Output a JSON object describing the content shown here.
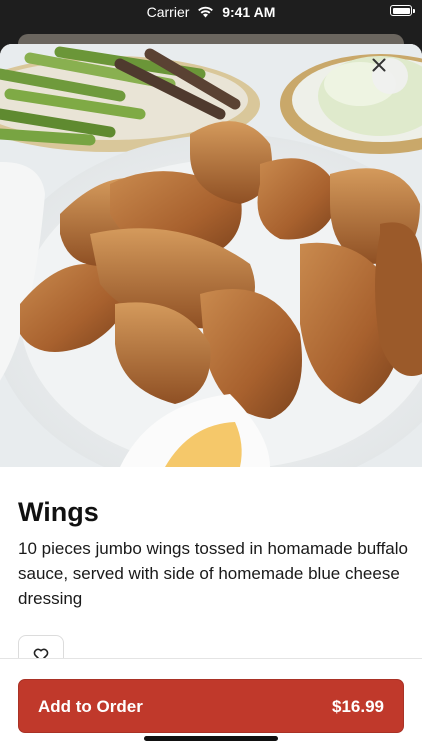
{
  "status_bar": {
    "carrier": "Carrier",
    "time": "9:41 AM",
    "icons": [
      "wifi-icon",
      "battery-icon"
    ]
  },
  "item": {
    "photo_subject": "fried chicken wings",
    "title": "Wings",
    "description": "10 pieces jumbo wings tossed in homamade buffalo sauce, served with side of homemade blue cheese dressing",
    "close_icon": "close-icon",
    "favorite_icon": "heart-icon"
  },
  "order": {
    "button_label": "Add to Order",
    "price": "$16.99"
  },
  "colors": {
    "accent": "#c0392b",
    "text": "#111111",
    "background": "#ffffff"
  }
}
